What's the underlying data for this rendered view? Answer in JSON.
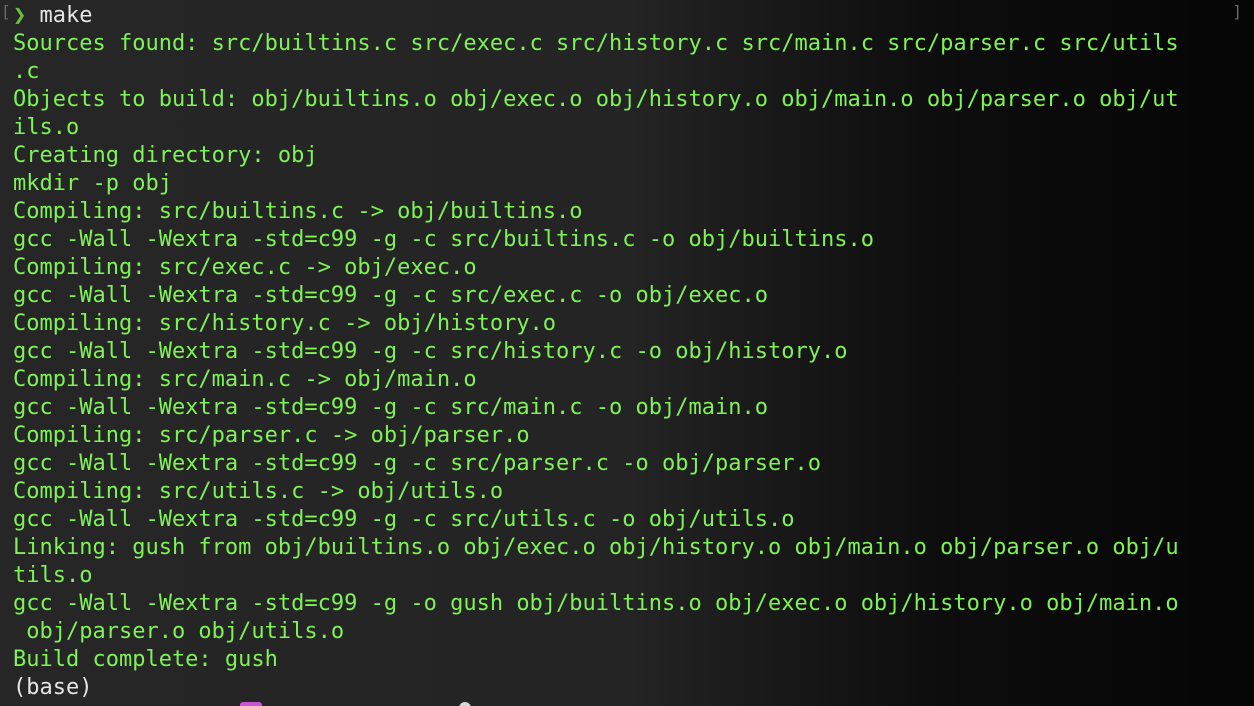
{
  "terminal": {
    "prompt_symbol": "❯",
    "command": "make",
    "output_lines": [
      "Sources found: src/builtins.c src/exec.c src/history.c src/main.c src/parser.c src/utils",
      ".c",
      "Objects to build: obj/builtins.o obj/exec.o obj/history.o obj/main.o obj/parser.o obj/ut",
      "ils.o",
      "Creating directory: obj",
      "mkdir -p obj",
      "Compiling: src/builtins.c -> obj/builtins.o",
      "gcc -Wall -Wextra -std=c99 -g -c src/builtins.c -o obj/builtins.o",
      "Compiling: src/exec.c -> obj/exec.o",
      "gcc -Wall -Wextra -std=c99 -g -c src/exec.c -o obj/exec.o",
      "Compiling: src/history.c -> obj/history.o",
      "gcc -Wall -Wextra -std=c99 -g -c src/history.c -o obj/history.o",
      "Compiling: src/main.c -> obj/main.o",
      "gcc -Wall -Wextra -std=c99 -g -c src/main.c -o obj/main.o",
      "Compiling: src/parser.c -> obj/parser.o",
      "gcc -Wall -Wextra -std=c99 -g -c src/parser.c -o obj/parser.o",
      "Compiling: src/utils.c -> obj/utils.o",
      "gcc -Wall -Wextra -std=c99 -g -c src/utils.c -o obj/utils.o",
      "Linking: gush from obj/builtins.o obj/exec.o obj/history.o obj/main.o obj/parser.o obj/u",
      "tils.o",
      "gcc -Wall -Wextra -std=c99 -g -o gush obj/builtins.o obj/exec.o obj/history.o obj/main.o",
      " obj/parser.o obj/utils.o",
      "Build complete: gush"
    ],
    "env_label": "(base)",
    "colors": {
      "background": "#1e1e1e",
      "output_text": "#7ef257",
      "prompt_symbol": "#6ac13d",
      "command_text": "#e6e6e6"
    }
  }
}
